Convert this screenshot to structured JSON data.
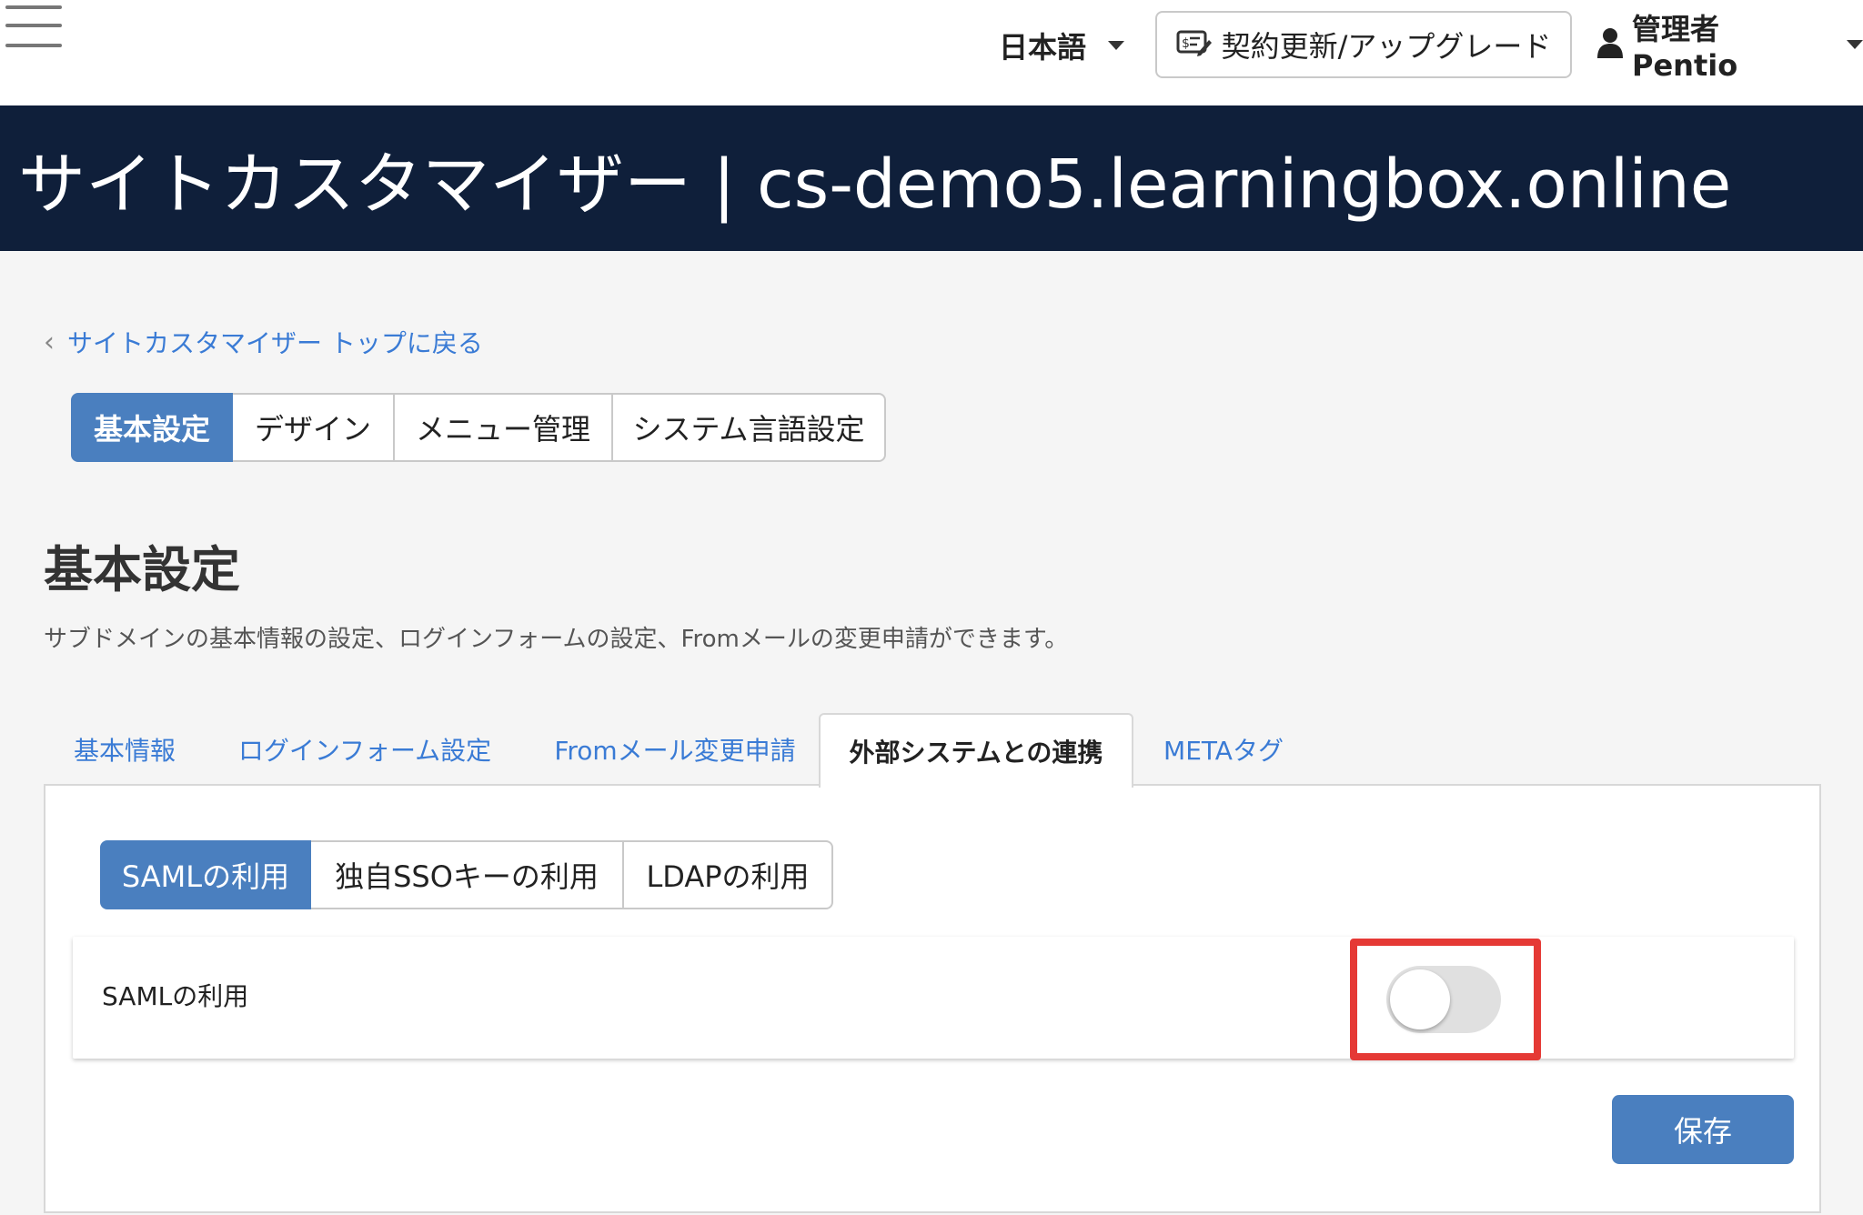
{
  "header": {
    "menu_icon": "hamburger-menu-icon",
    "language": "日本語",
    "upgrade_label": "契約更新/アップグレード",
    "upgrade_icon": "contract-edit-icon",
    "user_label": "管理者 Pentio",
    "user_icon": "user-icon"
  },
  "title_bar": {
    "title": "サイトカスタマイザー | cs-demo5.learningbox.online",
    "background": "#0f1f3a"
  },
  "back_link": {
    "label": "サイトカスタマイザー トップに戻る",
    "icon": "chevron-left-icon"
  },
  "main_tabs": [
    {
      "label": "基本設定",
      "active": true
    },
    {
      "label": "デザイン",
      "active": false
    },
    {
      "label": "メニュー管理",
      "active": false
    },
    {
      "label": "システム言語設定",
      "active": false
    }
  ],
  "section": {
    "title": "基本設定",
    "description": "サブドメインの基本情報の設定、ログインフォームの設定、Fromメールの変更申請ができます。"
  },
  "sub_tabs": [
    {
      "label": "基本情報",
      "active": false
    },
    {
      "label": "ログインフォーム設定",
      "active": false
    },
    {
      "label": "Fromメール変更申請",
      "active": false
    },
    {
      "label": "外部システムとの連携",
      "active": true
    },
    {
      "label": "METAタグ",
      "active": false
    }
  ],
  "integration_tabs": [
    {
      "label": "SAMLの利用",
      "active": true
    },
    {
      "label": "独自SSOキーの利用",
      "active": false
    },
    {
      "label": "LDAPの利用",
      "active": false
    }
  ],
  "saml_setting": {
    "label": "SAMLの利用",
    "enabled": false
  },
  "save_label": "保存",
  "colors": {
    "accent": "#4a7fbf",
    "link": "#3a7bd5",
    "highlight": "#e53935"
  }
}
